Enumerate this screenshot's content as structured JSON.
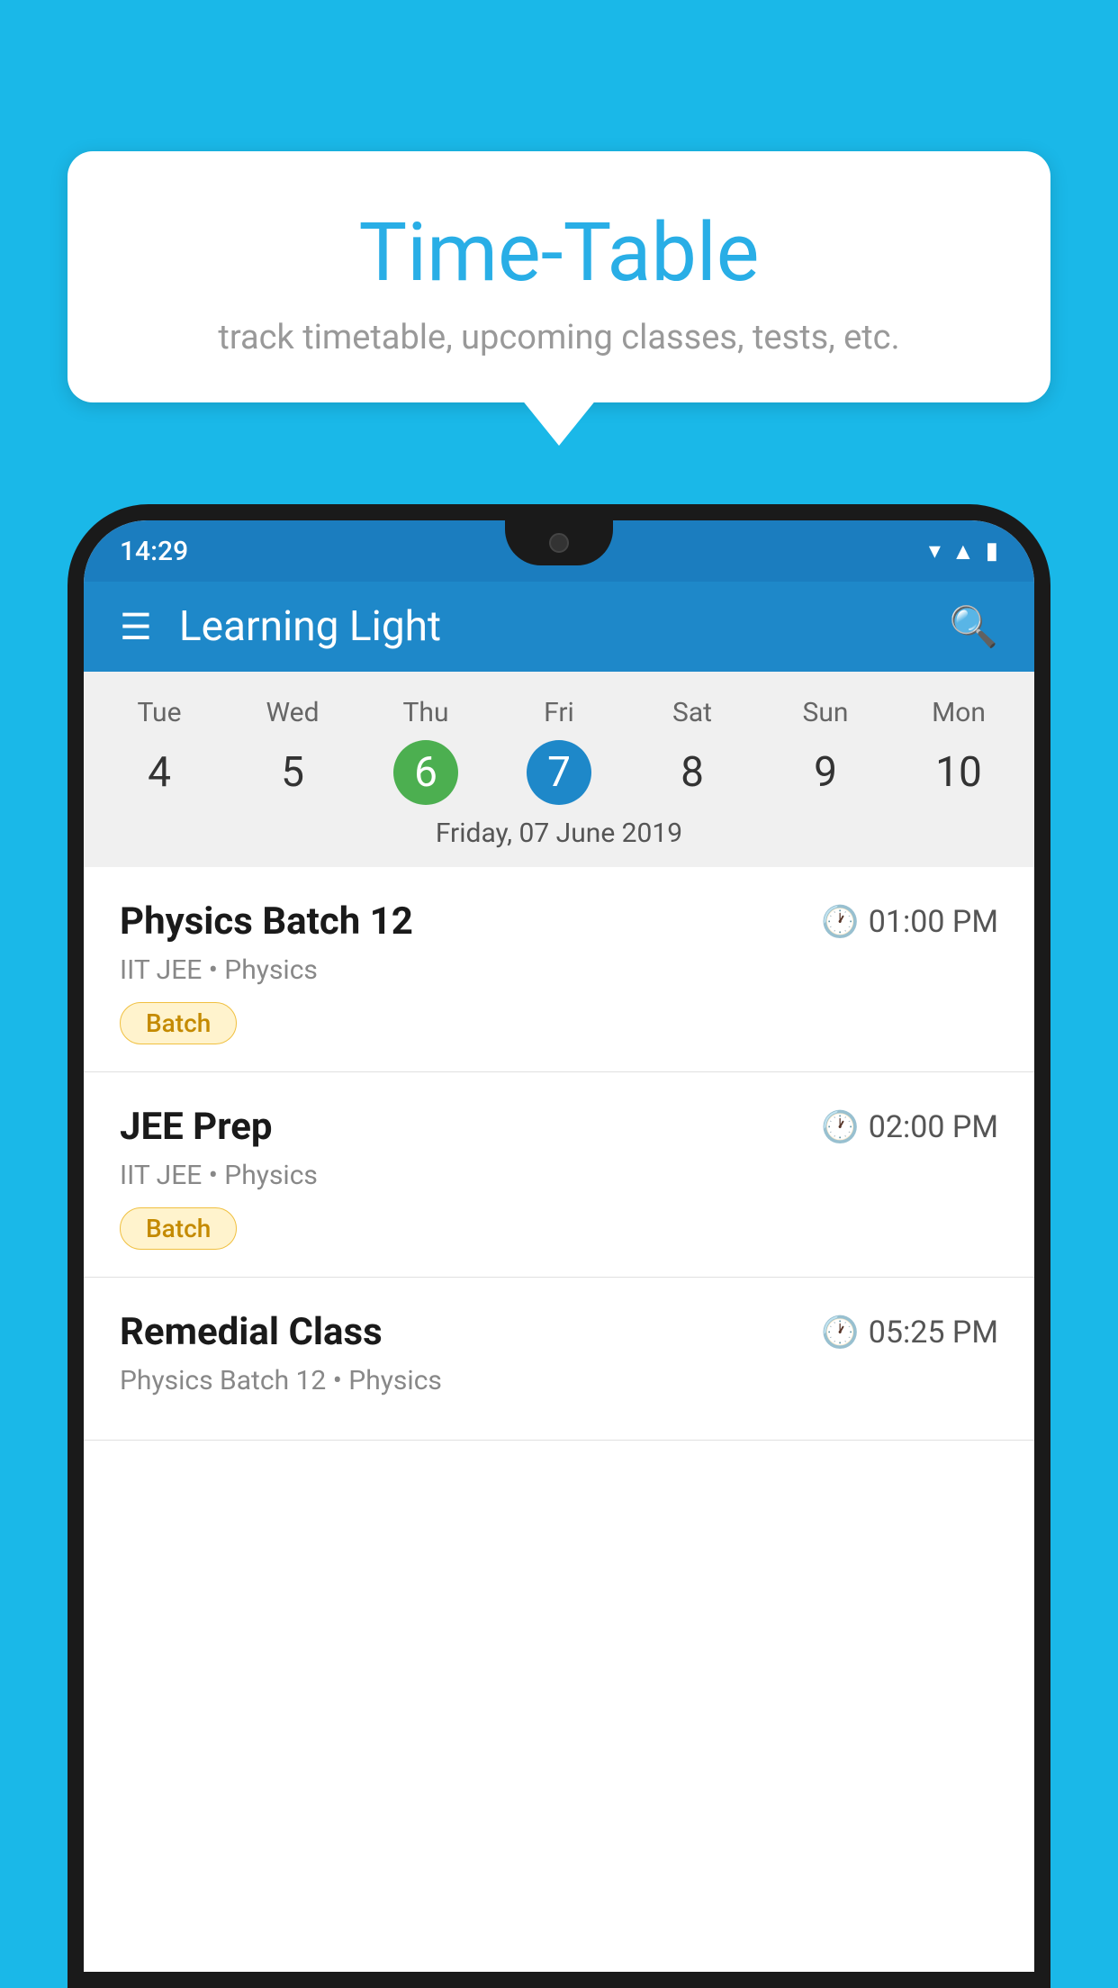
{
  "background_color": "#1ab8e8",
  "speech_bubble": {
    "title": "Time-Table",
    "subtitle": "track timetable, upcoming classes, tests, etc."
  },
  "phone": {
    "status_bar": {
      "time": "14:29"
    },
    "app_bar": {
      "title": "Learning Light"
    },
    "calendar": {
      "days": [
        "Tue",
        "Wed",
        "Thu",
        "Fri",
        "Sat",
        "Sun",
        "Mon"
      ],
      "dates": [
        "4",
        "5",
        "6",
        "7",
        "8",
        "9",
        "10"
      ],
      "today_index": 2,
      "selected_index": 3,
      "selected_label": "Friday, 07 June 2019"
    },
    "schedule_items": [
      {
        "title": "Physics Batch 12",
        "time": "01:00 PM",
        "meta": "IIT JEE • Physics",
        "badge": "Batch"
      },
      {
        "title": "JEE Prep",
        "time": "02:00 PM",
        "meta": "IIT JEE • Physics",
        "badge": "Batch"
      },
      {
        "title": "Remedial Class",
        "time": "05:25 PM",
        "meta": "Physics Batch 12 • Physics",
        "badge": null
      }
    ]
  }
}
